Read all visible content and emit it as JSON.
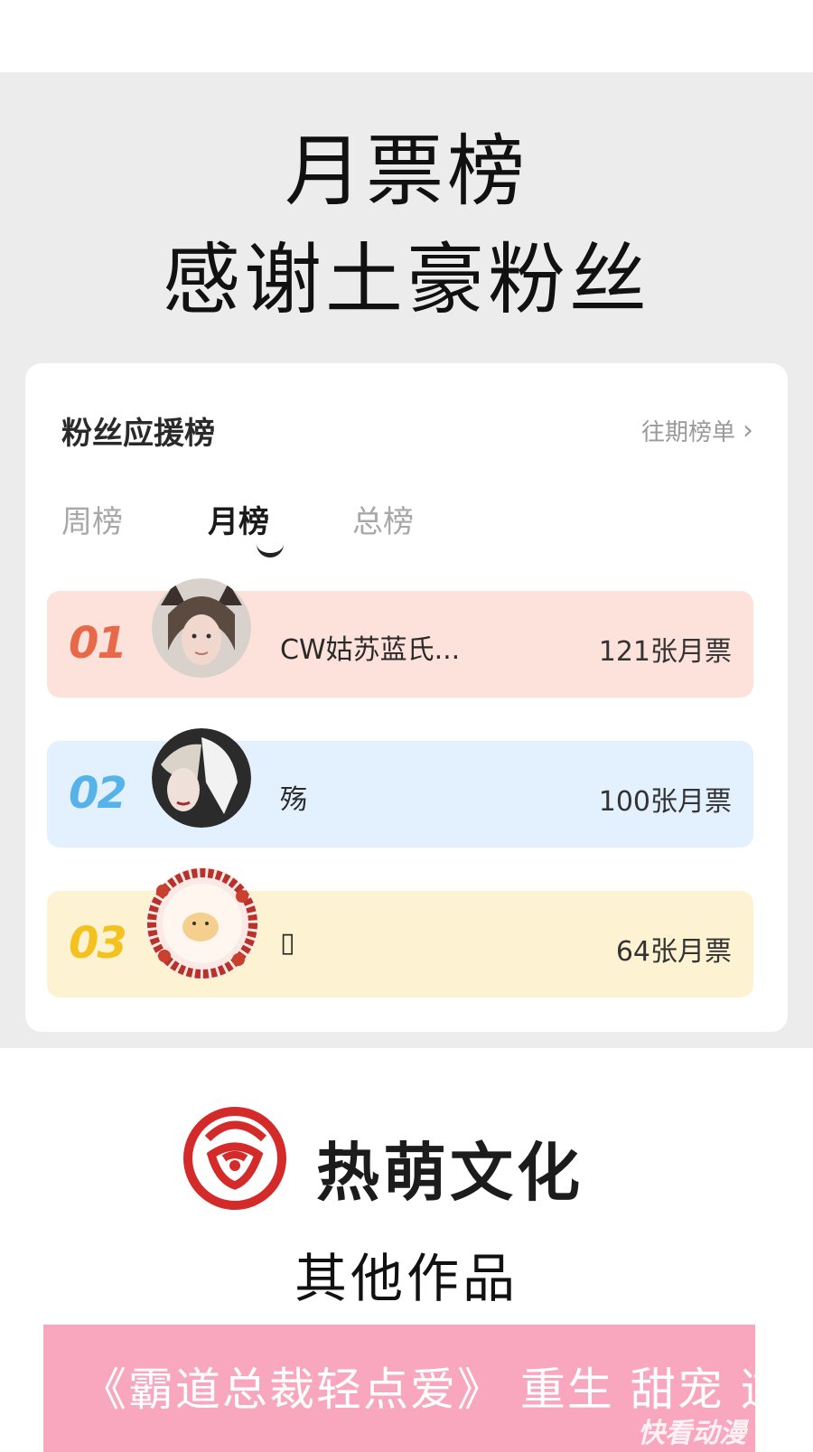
{
  "header": {
    "line1": "月票榜",
    "line2": "感谢土豪粉丝"
  },
  "card": {
    "title": "粉丝应援榜",
    "history_link": "往期榜单",
    "tabs": [
      "周榜",
      "月榜",
      "总榜"
    ],
    "active_tab": "月榜",
    "rows": [
      {
        "rank": "01",
        "name": "CW姑苏蓝氏...",
        "votes": "121张月票",
        "rank_color": "#e8694a",
        "row_bg": "#fde1db"
      },
      {
        "rank": "02",
        "name": "殇",
        "votes": "100张月票",
        "rank_color": "#55b3ea",
        "row_bg": "#e3f0fd"
      },
      {
        "rank": "03",
        "name": "▯",
        "votes": "64张月票",
        "rank_color": "#f3c21f",
        "row_bg": "#fdf2d1"
      }
    ]
  },
  "footer": {
    "brand": "热萌文化",
    "brand_color": "#d42a2a",
    "other_works": "其他作品",
    "banner_text": "《霸道总裁轻点爱》 重生 甜宠 逆袭",
    "watermark": "快看动漫"
  }
}
